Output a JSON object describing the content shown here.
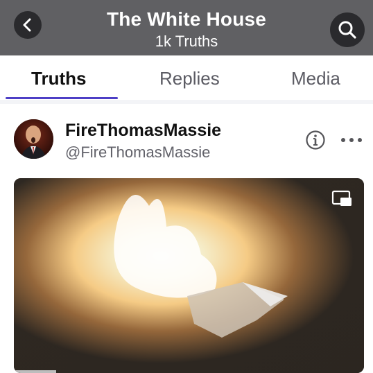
{
  "header": {
    "title": "The White House",
    "subtitle": "1k Truths",
    "back_icon": "chevron-left-icon",
    "search_icon": "search-icon",
    "background": "#606063"
  },
  "tabs": [
    {
      "label": "Truths",
      "active": true
    },
    {
      "label": "Replies",
      "active": false
    },
    {
      "label": "Media",
      "active": false
    }
  ],
  "accent_color": "#4d3fc6",
  "post": {
    "display_name": "FireThomasMassie",
    "handle": "@FireThomasMassie",
    "info_icon": "info-icon",
    "more_icon": "more-horizontal-icon",
    "media": {
      "type": "video",
      "pip_icon": "picture-in-picture-icon",
      "progress": 0.12
    }
  }
}
